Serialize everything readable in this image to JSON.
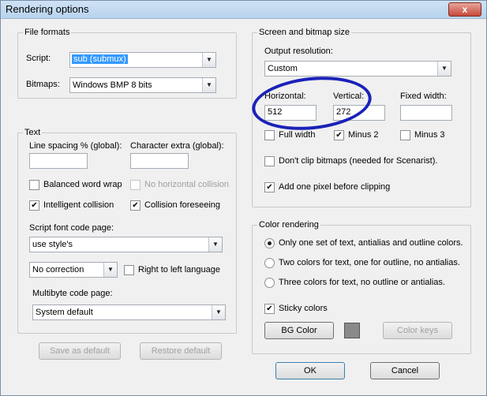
{
  "window": {
    "title": "Rendering options",
    "close_glyph": "x"
  },
  "file_formats": {
    "legend": "File formats",
    "script_label": "Script:",
    "script_value": "sub (submux)",
    "bitmaps_label": "Bitmaps:",
    "bitmaps_value": "Windows BMP 8 bits"
  },
  "text": {
    "legend": "Text",
    "line_spacing_label": "Line spacing % (global):",
    "line_spacing_value": "",
    "char_extra_label": "Character extra (global):",
    "char_extra_value": "",
    "balanced_wrap": {
      "label": "Balanced word wrap",
      "checked": false
    },
    "no_horizontal": {
      "label": "No horizontal collision",
      "checked": false,
      "disabled": true
    },
    "intelligent": {
      "label": "Intelligent collision",
      "checked": true
    },
    "foreseeing": {
      "label": "Collision foreseeing",
      "checked": true
    },
    "font_code_page_label": "Script font code page:",
    "font_code_page_value": "use style's",
    "correction_value": "No correction",
    "rtl": {
      "label": "Right to left language",
      "checked": false
    },
    "multibyte_label": "Multibyte code page:",
    "multibyte_value": "System default"
  },
  "screen": {
    "legend": "Screen and bitmap size",
    "output_res_label": "Output resolution:",
    "output_res_value": "Custom",
    "horizontal_label": "Horizontal:",
    "horizontal_value": "512",
    "vertical_label": "Vertical:",
    "vertical_value": "272",
    "fixed_width_label": "Fixed width:",
    "fixed_width_value": "",
    "full_width": {
      "label": "Full width",
      "checked": false
    },
    "minus2": {
      "label": "Minus 2",
      "checked": true
    },
    "minus3": {
      "label": "Minus 3",
      "checked": false
    },
    "dont_clip": {
      "label": "Don't clip bitmaps (needed for Scenarist).",
      "checked": false
    },
    "add_pixel": {
      "label": "Add one pixel before clipping",
      "checked": true
    }
  },
  "color": {
    "legend": "Color rendering",
    "opt1": {
      "label": "Only one set of text, antialias and outline colors.",
      "selected": true
    },
    "opt2": {
      "label": "Two colors for text, one for outline, no antialias.",
      "selected": false
    },
    "opt3": {
      "label": "Three colors for text, no outline or antialias.",
      "selected": false
    },
    "sticky": {
      "label": "Sticky colors",
      "checked": true
    },
    "bg_button": "BG Color",
    "bg_swatch": "#8a8a8a",
    "color_keys_button": "Color keys"
  },
  "buttons": {
    "save_default": "Save as default",
    "restore_default": "Restore default",
    "ok": "OK",
    "cancel": "Cancel"
  },
  "check_glyph": "✔",
  "dropdown_glyph": "▼",
  "colors": {
    "annotation_blue": "#1a22b8",
    "selection_blue": "#3399ff"
  }
}
